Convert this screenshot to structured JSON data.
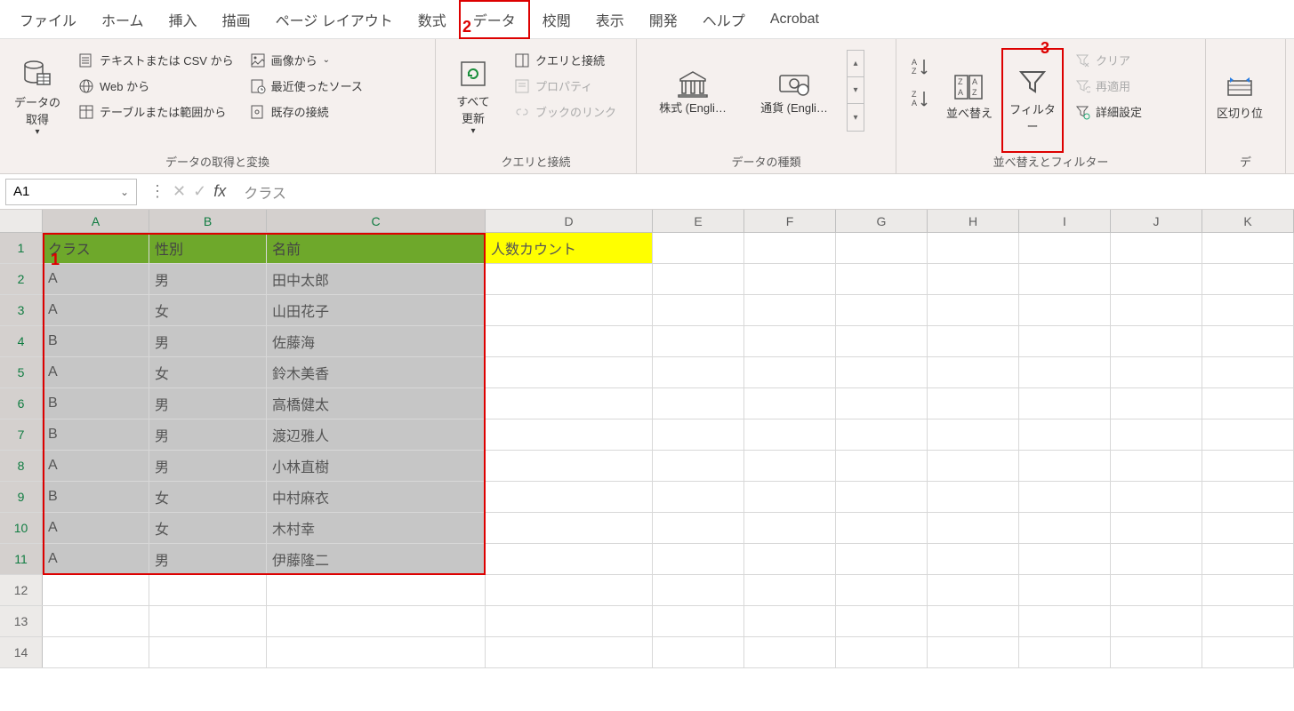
{
  "tabs": [
    "ファイル",
    "ホーム",
    "挿入",
    "描画",
    "ページ レイアウト",
    "数式",
    "データ",
    "校閲",
    "表示",
    "開発",
    "ヘルプ",
    "Acrobat"
  ],
  "activeTab": 6,
  "markers": {
    "m1": "1",
    "m2": "2",
    "m3": "3"
  },
  "ribbonGroups": {
    "getTransform": {
      "label": "データの取得と変換",
      "big": "データの\n取得",
      "items": [
        "テキストまたは CSV から",
        "Web から",
        "テーブルまたは範囲から",
        "画像から",
        "最近使ったソース",
        "既存の接続"
      ]
    },
    "query": {
      "label": "クエリと接続",
      "big": "すべて\n更新",
      "items": [
        "クエリと接続",
        "プロパティ",
        "ブックのリンク"
      ]
    },
    "dataType": {
      "label": "データの種類",
      "items": [
        "株式 (Engli…",
        "通貨 (Engli…"
      ]
    },
    "sortFilter": {
      "label": "並べ替えとフィルター",
      "sort": "並べ替え",
      "filter": "フィルター",
      "clear": "クリア",
      "reapply": "再適用",
      "advanced": "詳細設定"
    },
    "tools": {
      "label": "デ",
      "split": "区切り位"
    }
  },
  "nameBox": "A1",
  "formula": "クラス",
  "columns": [
    "A",
    "B",
    "C",
    "D",
    "E",
    "F",
    "G",
    "H",
    "I",
    "J",
    "K"
  ],
  "selectedCols": [
    0,
    1,
    2
  ],
  "headerRow": [
    "クラス",
    "性別",
    "名前",
    "人数カウント"
  ],
  "dataRows": [
    [
      "A",
      "男",
      "田中太郎"
    ],
    [
      "A",
      "女",
      "山田花子"
    ],
    [
      "B",
      "男",
      "佐藤海"
    ],
    [
      "A",
      "女",
      "鈴木美香"
    ],
    [
      "B",
      "男",
      "高橋健太"
    ],
    [
      "B",
      "男",
      "渡辺雅人"
    ],
    [
      "A",
      "男",
      "小林直樹"
    ],
    [
      "B",
      "女",
      "中村麻衣"
    ],
    [
      "A",
      "女",
      "木村幸"
    ],
    [
      "A",
      "男",
      "伊藤隆二"
    ]
  ],
  "emptyRows": [
    12,
    13,
    14
  ]
}
